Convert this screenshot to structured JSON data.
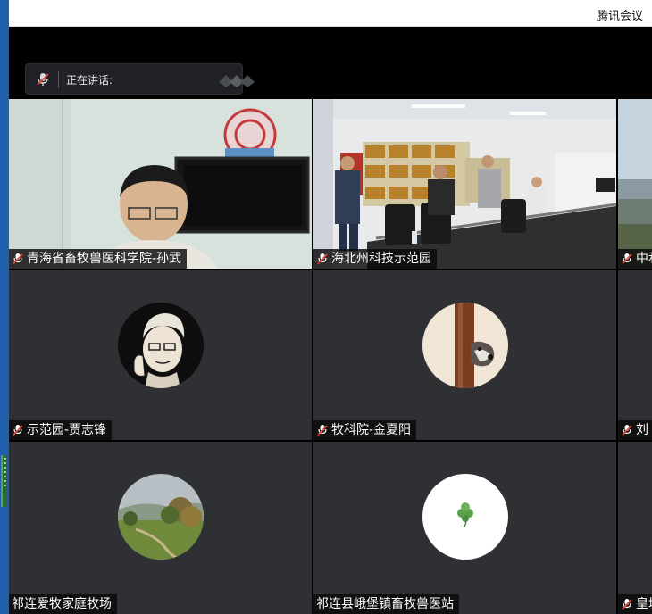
{
  "window": {
    "title": "腾讯会议"
  },
  "speaking": {
    "label": "正在讲话:"
  },
  "participants": [
    {
      "name": "青海省畜牧兽医科学院-孙武",
      "type": "video",
      "mic": "muted"
    },
    {
      "name": "海北州科技示范园",
      "type": "video",
      "mic": "muted"
    },
    {
      "name": "中利",
      "type": "video",
      "mic": "muted"
    },
    {
      "name": "示范园-贾志锋",
      "type": "avatar",
      "mic": "muted"
    },
    {
      "name": "牧科院-金夏阳",
      "type": "avatar",
      "mic": "muted"
    },
    {
      "name": "刘",
      "type": "avatar",
      "mic": "muted"
    },
    {
      "name": "祁连爱牧家庭牧场",
      "type": "avatar",
      "mic": "none"
    },
    {
      "name": "祁连县峨堡镇畜牧兽医站",
      "type": "avatar",
      "mic": "none"
    },
    {
      "name": "皇城",
      "type": "avatar",
      "mic": "muted"
    }
  ],
  "colors": {
    "mic_muted": "#e0463c",
    "tile_bg": "#2e3034",
    "left_strip": "#1e5fae"
  }
}
